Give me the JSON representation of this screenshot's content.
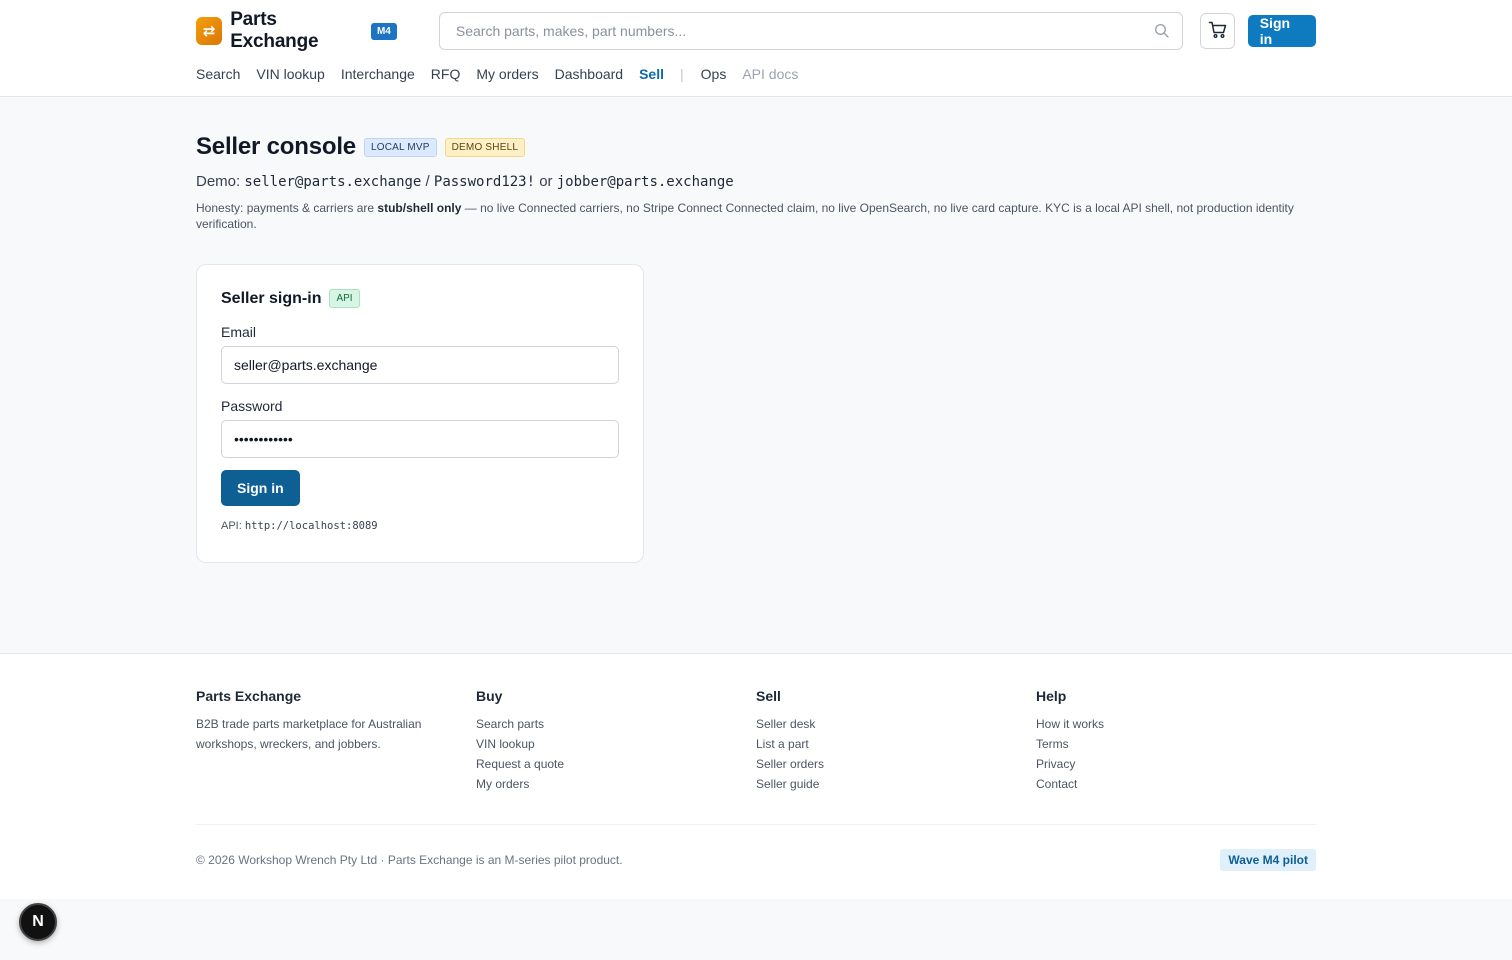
{
  "header": {
    "brand_name": "Parts Exchange",
    "brand_badge": "M4",
    "search_placeholder": "Search parts, makes, part numbers...",
    "signin_label": "Sign in",
    "nav": [
      {
        "label": "Search"
      },
      {
        "label": "VIN lookup"
      },
      {
        "label": "Interchange"
      },
      {
        "label": "RFQ"
      },
      {
        "label": "My orders"
      },
      {
        "label": "Dashboard"
      },
      {
        "label": "Sell",
        "active": true
      },
      {
        "label": "Ops"
      },
      {
        "label": "API docs"
      }
    ],
    "nav_separator": "|"
  },
  "page": {
    "title": "Seller console",
    "badge_local": "LOCAL MVP",
    "badge_demo": "DEMO SHELL",
    "demo_prefix": "Demo:",
    "demo_email": "seller@parts.exchange",
    "demo_slash": "/",
    "demo_password": "Password123!",
    "demo_or": "or",
    "demo_email2": "jobber@parts.exchange",
    "honesty_prefix": "Honesty: payments & carriers are",
    "honesty_bold": "stub/shell only",
    "honesty_rest": "— no live Connected carriers, no Stripe Connect Connected claim, no live OpenSearch, no live card capture. KYC is a local API shell, not production identity verification."
  },
  "signin_card": {
    "title": "Seller sign-in",
    "badge": "API",
    "email_label": "Email",
    "email_value": "seller@parts.exchange",
    "password_label": "Password",
    "password_value": "••••••••••••",
    "submit_label": "Sign in",
    "api_label": "API:",
    "api_url": "http://localhost:8089"
  },
  "footer": {
    "about_title": "Parts Exchange",
    "about_text": "B2B trade parts marketplace for Australian workshops, wreckers, and jobbers.",
    "buy_title": "Buy",
    "buy_links": [
      "Search parts",
      "VIN lookup",
      "Request a quote",
      "My orders"
    ],
    "sell_title": "Sell",
    "sell_links": [
      "Seller desk",
      "List a part",
      "Seller orders",
      "Seller guide"
    ],
    "help_title": "Help",
    "help_links": [
      "How it works",
      "Terms",
      "Privacy",
      "Contact"
    ],
    "copyright": "© 2026 Workshop Wrench Pty Ltd · Parts Exchange is an M-series pilot product.",
    "wave_badge": "Wave M4 pilot"
  },
  "devtools_label": "N",
  "colors": {
    "accent": "#0e7abf",
    "brand_logo": "#f59e0b",
    "active_nav": "#0e6aa8"
  },
  "icons": {
    "logo": "swap-arrows-icon",
    "search": "search-icon",
    "cart": "cart-icon"
  }
}
